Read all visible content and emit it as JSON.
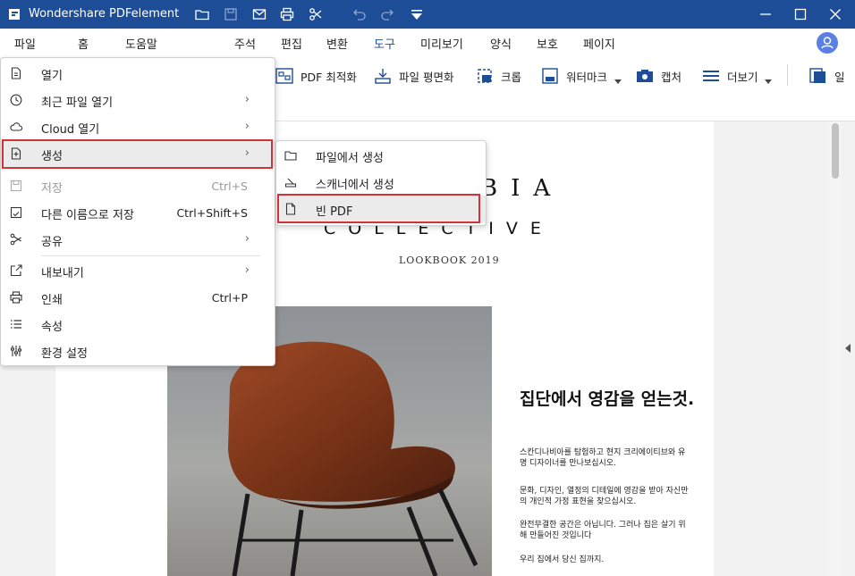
{
  "titlebar": {
    "title": "Wondershare PDFelement"
  },
  "menubar": {
    "tabs": [
      {
        "label": "파일",
        "name": "tab-file"
      },
      {
        "label": "홈",
        "name": "tab-home"
      },
      {
        "label": "도움말",
        "name": "tab-help"
      },
      {
        "label": "주석",
        "name": "tab-comment"
      },
      {
        "label": "편집",
        "name": "tab-edit"
      },
      {
        "label": "변환",
        "name": "tab-convert"
      },
      {
        "label": "도구",
        "name": "tab-tools"
      },
      {
        "label": "미리보기",
        "name": "tab-view"
      },
      {
        "label": "양식",
        "name": "tab-form"
      },
      {
        "label": "보호",
        "name": "tab-protect"
      },
      {
        "label": "페이지",
        "name": "tab-page"
      }
    ],
    "active_tab": "도구"
  },
  "toolbar": {
    "pdf_optimize": "PDF 최적화",
    "flatten": "파일 평면화",
    "crop": "크롭",
    "watermark": "워터마크",
    "capture": "캡처",
    "more": "더보기",
    "truncated": "일"
  },
  "file_menu": {
    "items": [
      {
        "label": "열기",
        "shortcut": "",
        "arrow": "",
        "icon": "open-file-icon"
      },
      {
        "label": "최근 파일 열기",
        "shortcut": "",
        "arrow": "›",
        "icon": "clock-icon"
      },
      {
        "label": "Cloud 열기",
        "shortcut": "",
        "arrow": "›",
        "icon": "cloud-icon"
      },
      {
        "label": "생성",
        "shortcut": "",
        "arrow": "›",
        "icon": "create-icon"
      },
      {
        "label": "저장",
        "shortcut": "Ctrl+S",
        "arrow": "",
        "icon": "save-icon"
      },
      {
        "label": "다른 이름으로 저장",
        "shortcut": "Ctrl+Shift+S",
        "arrow": "",
        "icon": "save-as-icon"
      },
      {
        "label": "공유",
        "shortcut": "",
        "arrow": "›",
        "icon": "share-icon"
      },
      {
        "label": "내보내기",
        "shortcut": "",
        "arrow": "›",
        "icon": "export-icon"
      },
      {
        "label": "인쇄",
        "shortcut": "Ctrl+P",
        "arrow": "",
        "icon": "print-icon"
      },
      {
        "label": "속성",
        "shortcut": "",
        "arrow": "",
        "icon": "properties-icon"
      },
      {
        "label": "환경 설정",
        "shortcut": "",
        "arrow": "",
        "icon": "preferences-icon"
      }
    ]
  },
  "create_submenu": {
    "items": [
      {
        "label": "파일에서 생성",
        "icon": "folder-icon"
      },
      {
        "label": "스캐너에서 생성",
        "icon": "scanner-icon"
      },
      {
        "label": "빈 PDF",
        "icon": "blank-page-icon"
      }
    ]
  },
  "document": {
    "brand_line1": "BIA",
    "brand_line2": "COLLECTIVE",
    "brand_line3": "LOOKBOOK 2019",
    "headline": "집단에서 영감을 얻는것.",
    "paragraphs": [
      "스칸디나비아를 탐험하고 현지 크리에이티브와 유명 디자이너를 만나보십시오.",
      "문화, 디자인, 열정의 디테일에 영감을 받아 자신만의 개인적 가정 표현을 찾으십시오.",
      "완전무결한 공간은 아닙니다. 그러나 집은 살기 위해 만들어진 것입니다",
      "우리 집에서 당신 집까지."
    ]
  },
  "colors": {
    "titlebar_bg": "#1d4d97",
    "highlight_border": "#d0343a",
    "avatar": "#5b7fe4"
  }
}
